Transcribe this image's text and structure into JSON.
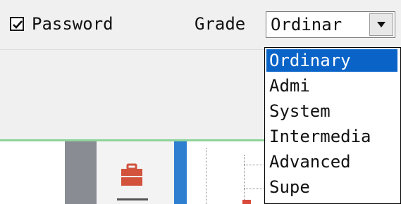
{
  "password_checkbox": {
    "label": "Password",
    "checked": true
  },
  "grade": {
    "label": "Grade",
    "selected_value": "Ordinar",
    "options": [
      "Ordinary",
      "Admi",
      "System",
      "Intermedia",
      "Advanced",
      "Supe"
    ],
    "highlighted_option": "Ordinary"
  },
  "icons": {
    "checkbox_check": "check-icon",
    "dropdown_arrow": "chevron-down-icon",
    "toolbox": "toolbox-icon"
  },
  "colors": {
    "selection": "#0a64c8",
    "accent_line": "#8fd49b",
    "toolbox_icon": "#d2523c"
  }
}
